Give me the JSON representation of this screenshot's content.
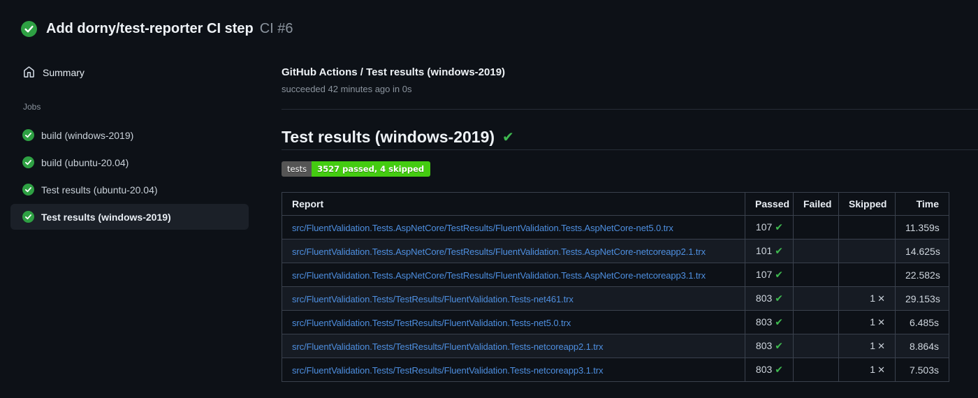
{
  "colors": {
    "page_bg": "#0d1117",
    "success_green": "#2ea043",
    "check_green": "#3fb950",
    "link_blue": "#4e8fe0",
    "badge_label_bg": "#555555",
    "badge_value_bg": "#44cc11",
    "row_alt_bg": "#161b23",
    "selected_job_bg": "#1b2028"
  },
  "icons": {
    "check": "✔",
    "x": "✕"
  },
  "header": {
    "title": "Add dorny/test-reporter CI step",
    "run_ref": "CI #6"
  },
  "sidebar": {
    "summary": {
      "label": "Summary"
    },
    "jobs_heading": "Jobs",
    "jobs": [
      {
        "label": "build (windows-2019)",
        "status": "success",
        "selected": false
      },
      {
        "label": "build (ubuntu-20.04)",
        "status": "success",
        "selected": false
      },
      {
        "label": "Test results (ubuntu-20.04)",
        "status": "success",
        "selected": false
      },
      {
        "label": "Test results (windows-2019)",
        "status": "success",
        "selected": true
      }
    ]
  },
  "main": {
    "check_name": "GitHub Actions / Test results (windows-2019)",
    "check_status": "succeeded 42 minutes ago in 0s",
    "report_title": "Test results (windows-2019)",
    "badge": {
      "label": "tests",
      "value": "3527 passed, 4 skipped"
    },
    "table": {
      "columns": [
        "Report",
        "Passed",
        "Failed",
        "Skipped",
        "Time"
      ],
      "rows": [
        {
          "report": "src/FluentValidation.Tests.AspNetCore/TestResults/FluentValidation.Tests.AspNetCore-net5.0.trx",
          "passed": "107",
          "failed": null,
          "skipped": null,
          "time": "11.359s"
        },
        {
          "report": "src/FluentValidation.Tests.AspNetCore/TestResults/FluentValidation.Tests.AspNetCore-netcoreapp2.1.trx",
          "passed": "101",
          "failed": null,
          "skipped": null,
          "time": "14.625s"
        },
        {
          "report": "src/FluentValidation.Tests.AspNetCore/TestResults/FluentValidation.Tests.AspNetCore-netcoreapp3.1.trx",
          "passed": "107",
          "failed": null,
          "skipped": null,
          "time": "22.582s"
        },
        {
          "report": "src/FluentValidation.Tests/TestResults/FluentValidation.Tests-net461.trx",
          "passed": "803",
          "failed": null,
          "skipped": "1",
          "time": "29.153s"
        },
        {
          "report": "src/FluentValidation.Tests/TestResults/FluentValidation.Tests-net5.0.trx",
          "passed": "803",
          "failed": null,
          "skipped": "1",
          "time": "6.485s"
        },
        {
          "report": "src/FluentValidation.Tests/TestResults/FluentValidation.Tests-netcoreapp2.1.trx",
          "passed": "803",
          "failed": null,
          "skipped": "1",
          "time": "8.864s"
        },
        {
          "report": "src/FluentValidation.Tests/TestResults/FluentValidation.Tests-netcoreapp3.1.trx",
          "passed": "803",
          "failed": null,
          "skipped": "1",
          "time": "7.503s"
        }
      ]
    }
  }
}
